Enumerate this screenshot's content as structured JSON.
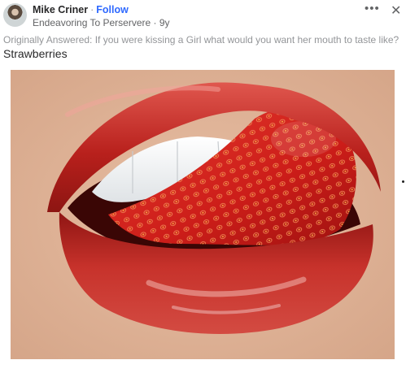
{
  "author": {
    "name": "Mike Criner",
    "separator": "·",
    "follow_label": "Follow",
    "credential": "Endeavoring To Perservere · 9y"
  },
  "actions": {
    "more_icon": "more-horizontal-icon",
    "close_icon": "close-icon"
  },
  "question": {
    "originally_answered": "Originally Answered: If you were kissing a Girl what would you want her mouth to taste like?"
  },
  "answer": {
    "text": "Strawberries"
  },
  "image": {
    "subject": "strawberry-lips-photo"
  },
  "colors": {
    "follow": "#2e69ff",
    "lips": "#c2221f",
    "strawberry": "#d0201c"
  }
}
